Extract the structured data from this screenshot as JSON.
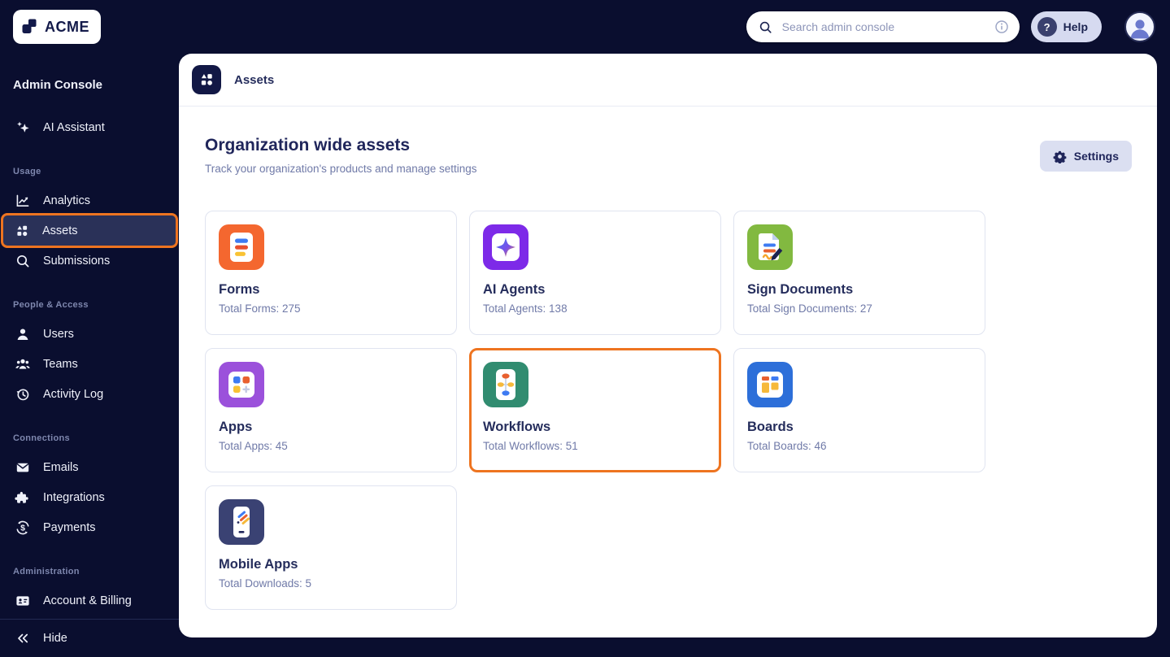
{
  "colors": {
    "page_background": "#0A0E2F",
    "accent_orange": "#EE7420",
    "active_item_background": "#2A3158",
    "panel_background": "#FFFFFF",
    "heading_navy": "#20265B",
    "muted_text": "#707AA8",
    "sidebar_section_label": "#7E87AE"
  },
  "topbar": {
    "logo_text": "ACME",
    "logo_icon": "acme-logo-mark",
    "search": {
      "placeholder": "Search admin console",
      "icon": "search-icon",
      "trailing_icon": "info-icon"
    },
    "help_label": "Help",
    "help_icon": "question-circle-icon",
    "avatar_icon": "user-avatar-icon"
  },
  "sidebar": {
    "title": "Admin Console",
    "standalone_items": [
      {
        "label": "AI Assistant",
        "icon": "sparkles-icon"
      }
    ],
    "sections": [
      {
        "label": "Usage",
        "items": [
          {
            "label": "Analytics",
            "icon": "analytics-icon"
          },
          {
            "label": "Assets",
            "icon": "assets-icon",
            "active": true,
            "highlighted": true
          },
          {
            "label": "Submissions",
            "icon": "search-icon"
          }
        ]
      },
      {
        "label": "People & Access",
        "items": [
          {
            "label": "Users",
            "icon": "user-icon"
          },
          {
            "label": "Teams",
            "icon": "teams-icon"
          },
          {
            "label": "Activity Log",
            "icon": "activity-clock-icon"
          }
        ]
      },
      {
        "label": "Connections",
        "items": [
          {
            "label": "Emails",
            "icon": "envelope-icon"
          },
          {
            "label": "Integrations",
            "icon": "puzzle-icon"
          },
          {
            "label": "Payments",
            "icon": "dollar-refresh-icon"
          }
        ]
      },
      {
        "label": "Administration",
        "items": [
          {
            "label": "Account & Billing",
            "icon": "id-card-icon"
          }
        ]
      }
    ],
    "hide_label": "Hide",
    "hide_icon": "double-chevron-left-icon"
  },
  "main": {
    "breadcrumb": "Assets",
    "header_icon": "assets-icon",
    "title": "Organization wide assets",
    "subtitle": "Track your organization's products and manage settings",
    "settings_label": "Settings",
    "settings_icon": "gear-icon",
    "cards": [
      {
        "title": "Forms",
        "stat": "Total Forms: 275",
        "icon": "forms-icon",
        "color": "#F4672F"
      },
      {
        "title": "AI Agents",
        "stat": "Total Agents: 138",
        "icon": "ai-agents-icon",
        "color": "#7D2AE8"
      },
      {
        "title": "Sign Documents",
        "stat": "Total Sign Documents: 27",
        "icon": "sign-documents-icon",
        "color": "#82B940"
      },
      {
        "title": "Apps",
        "stat": "Total Apps: 45",
        "icon": "apps-icon",
        "color": "#9B51DB"
      },
      {
        "title": "Workflows",
        "stat": "Total Workflows: 51",
        "icon": "workflows-icon",
        "color": "#318C70",
        "highlighted": true
      },
      {
        "title": "Boards",
        "stat": "Total Boards: 46",
        "icon": "boards-icon",
        "color": "#2D6FD9"
      },
      {
        "title": "Mobile Apps",
        "stat": "Total Downloads: 5",
        "icon": "mobile-apps-icon",
        "color": "#3A4273"
      }
    ]
  }
}
